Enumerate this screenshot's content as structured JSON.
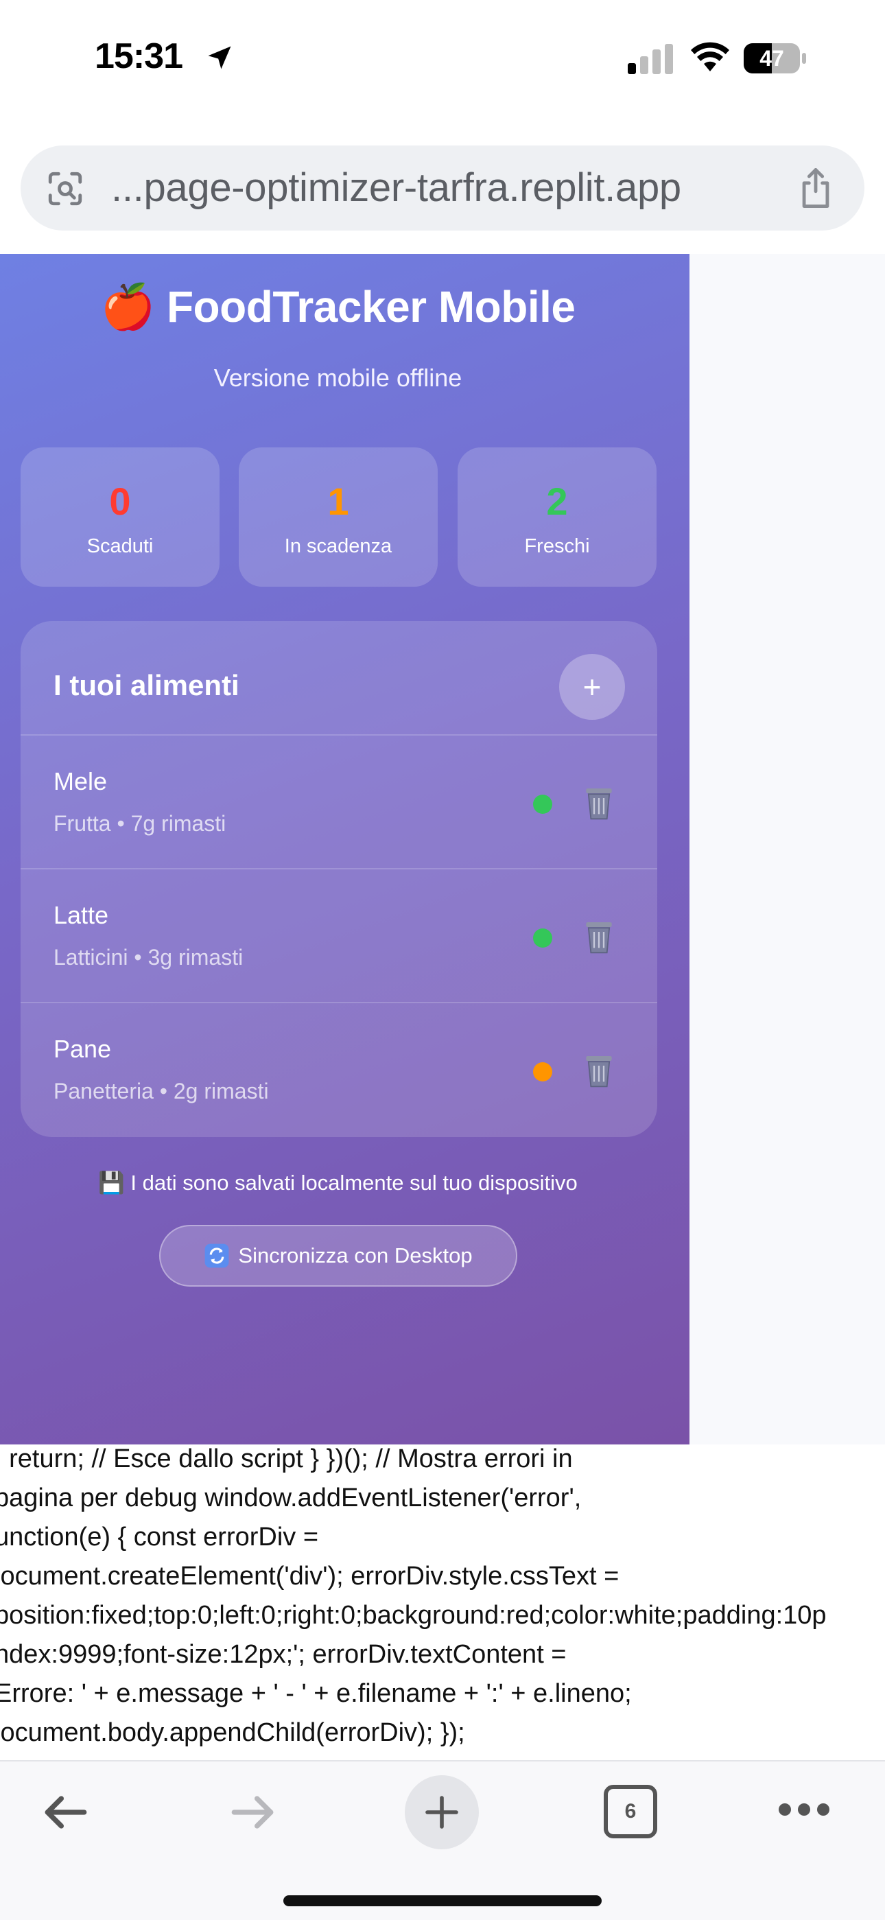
{
  "status_bar": {
    "time": "15:31",
    "battery": "47"
  },
  "browser": {
    "url": "...page-optimizer-tarfra.replit.app",
    "tab_count": "6"
  },
  "app": {
    "title": "🍎 FoodTracker Mobile",
    "subtitle": "Versione mobile offline",
    "stats": [
      {
        "value": "0",
        "label": "Scaduti",
        "color": "#ff3b30"
      },
      {
        "value": "1",
        "label": "In scadenza",
        "color": "#ff9500"
      },
      {
        "value": "2",
        "label": "Freschi",
        "color": "#34c759"
      }
    ],
    "panel": {
      "title": "I tuoi alimenti",
      "add_label": "+",
      "items": [
        {
          "name": "Mele",
          "meta": "Frutta • 7g rimasti",
          "status_color": "#34c759"
        },
        {
          "name": "Latte",
          "meta": "Latticini • 3g rimasti",
          "status_color": "#34c759"
        },
        {
          "name": "Pane",
          "meta": "Panetteria • 2g rimasti",
          "status_color": "#ff9500"
        }
      ]
    },
    "local_note": "💾 I dati sono salvati localmente sul tuo dispositivo",
    "sync_label": "Sincronizza con Desktop"
  },
  "code_lines": [
    "; return; // Esce dallo script } })(); // Mostra errori in",
    "pagina per debug window.addEventListener('error',",
    "unction(e) { const errorDiv =",
    "locument.createElement('div'); errorDiv.style.cssText =",
    "position:fixed;top:0;left:0;right:0;background:red;color:white;padding:10p",
    "ndex:9999;font-size:12px;'; errorDiv.textContent =",
    "Errore: ' + e.message + ' - ' + e.filename + ':' + e.lineno;",
    "locument.body.appendChild(errorDiv); });"
  ]
}
